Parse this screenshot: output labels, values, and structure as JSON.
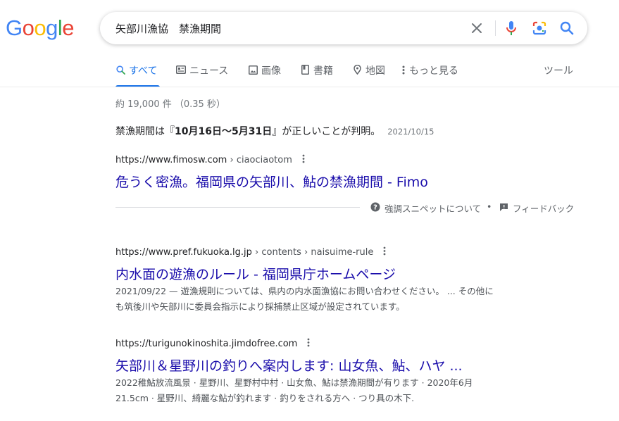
{
  "logo": {
    "text": "Google",
    "letters": [
      {
        "ch": "G",
        "color": "#4285F4"
      },
      {
        "ch": "o",
        "color": "#EA4335"
      },
      {
        "ch": "o",
        "color": "#FBBC05"
      },
      {
        "ch": "g",
        "color": "#4285F4"
      },
      {
        "ch": "l",
        "color": "#34A853"
      },
      {
        "ch": "e",
        "color": "#EA4335"
      }
    ]
  },
  "search": {
    "query": "矢部川漁協　禁漁期間"
  },
  "tabs": [
    {
      "label": "すべて",
      "icon": "search-icon"
    },
    {
      "label": "ニュース",
      "icon": "news-icon"
    },
    {
      "label": "画像",
      "icon": "image-icon"
    },
    {
      "label": "書籍",
      "icon": "book-icon"
    },
    {
      "label": "地図",
      "icon": "map-pin-icon"
    },
    {
      "label": "もっと見る",
      "icon": "more-vert-icon"
    }
  ],
  "tools_label": "ツール",
  "stats": "約 19,000 件 （0.35 秒）",
  "featured": {
    "pre": "禁漁期間は『",
    "bold": "10月16日〜5月31日",
    "post": "』が正しいことが判明。",
    "date": "2021/10/15",
    "url": "https://www.fimosw.com",
    "url_path": " › ciaociaotom",
    "title": "危うく密漁。福岡県の矢部川、鮎の禁漁期間 - Fimo",
    "about": "強調スニペットについて",
    "dot": "•",
    "feedback": "フィードバック"
  },
  "results": [
    {
      "url": "https://www.pref.fukuoka.lg.jp",
      "url_path": " › contents › naisuime-rule",
      "title": "内水面の遊漁のルール - 福岡県庁ホームページ",
      "desc_line1": "2021/09/22 — 遊漁規則については、県内の内水面漁協にお問い合わせください。 ... その他に",
      "desc_line2": "も筑後川や矢部川に委員会指示により採捕禁止区域が設定されています。"
    },
    {
      "url": "https://turigunokinoshita.jimdofree.com",
      "url_path": "",
      "title": "矢部川＆星野川の釣りへ案内します: 山女魚、鮎、ハヤ ...",
      "desc_line1": "2022稚鮎放流風景 · 星野川、星野村中村 · 山女魚、鮎は禁漁期間が有ります · 2020年6月",
      "desc_line2": "21.5cm · 星野川、綺麗な鮎が釣れます · 釣りをされる方へ · つり具の木下."
    }
  ]
}
